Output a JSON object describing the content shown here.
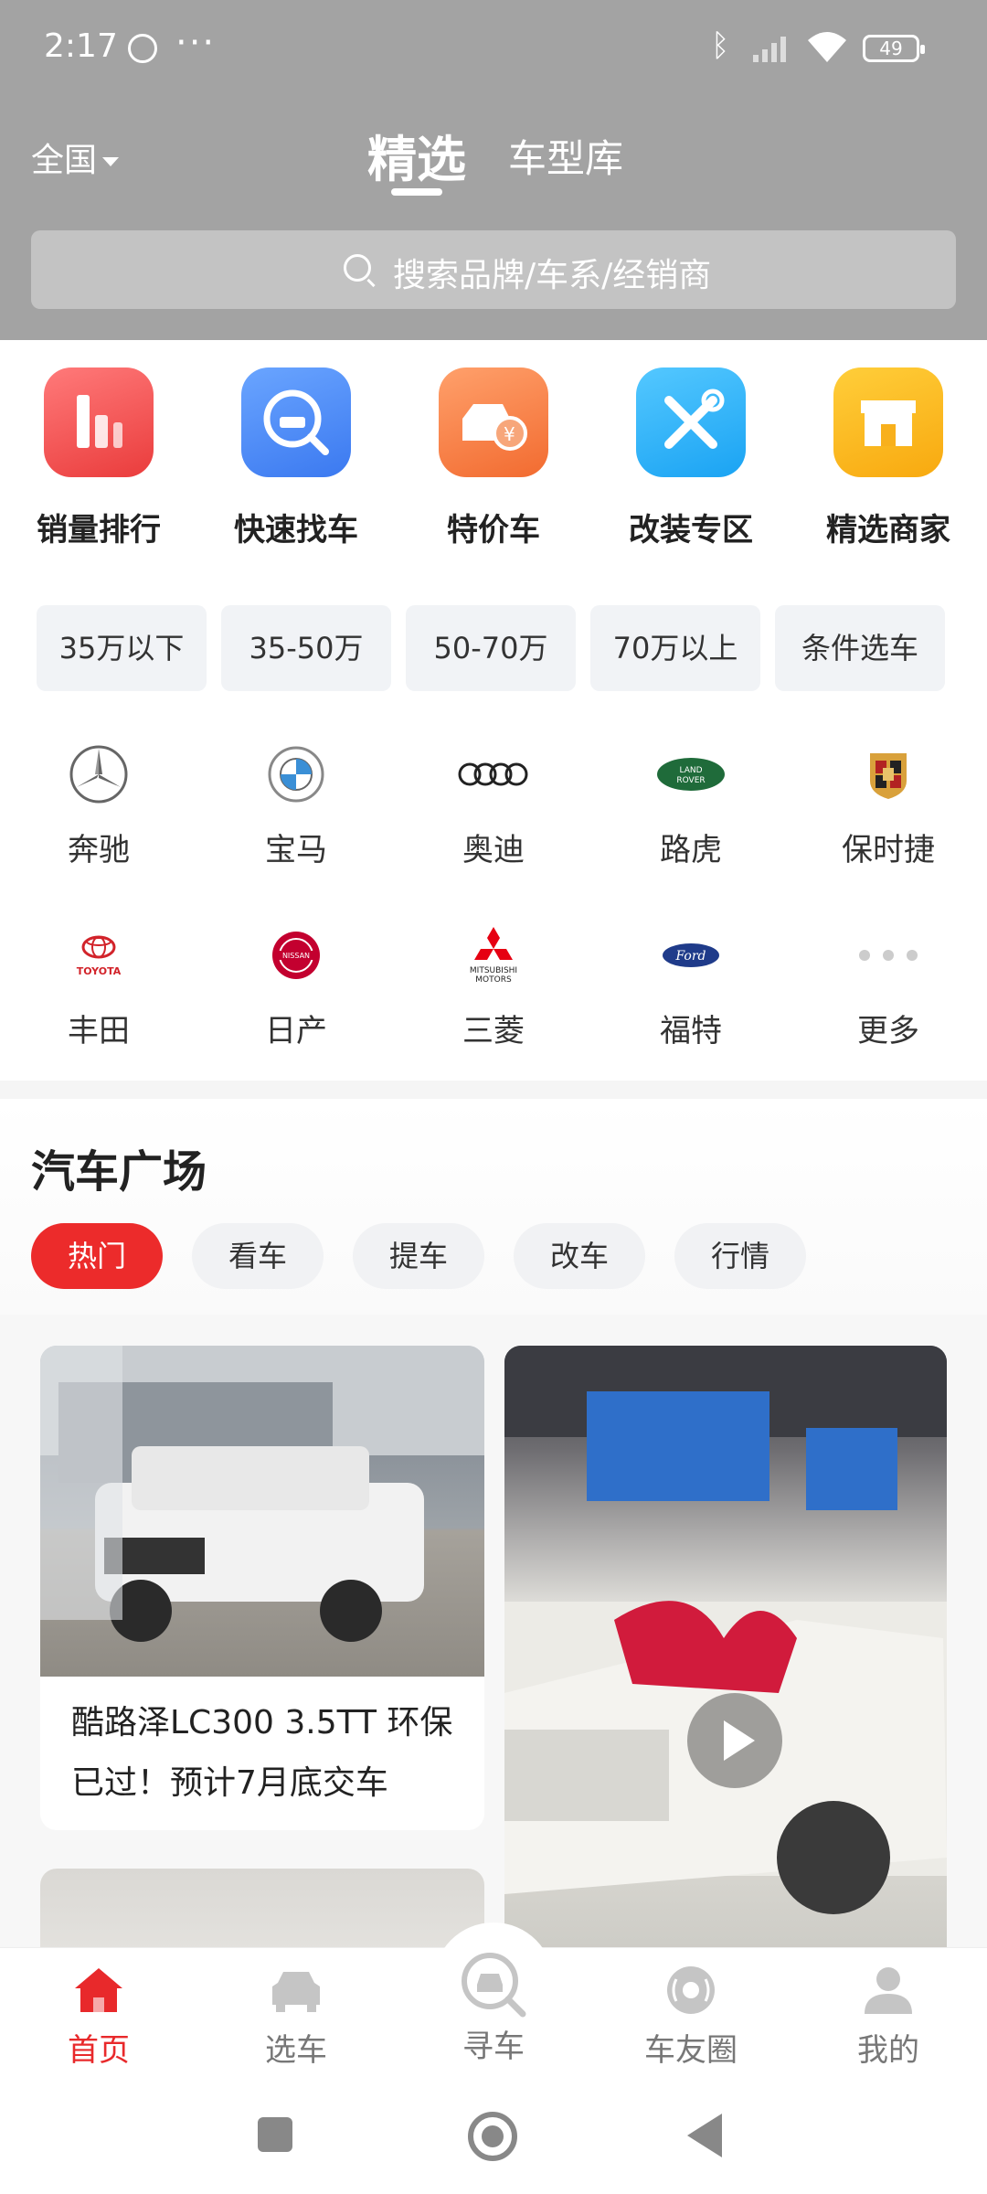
{
  "status_bar": {
    "time": "2:17",
    "dots": "···",
    "battery": "49"
  },
  "header": {
    "region": "全国",
    "tabs": [
      {
        "label": "精选",
        "active": true
      },
      {
        "label": "车型库",
        "active": false
      }
    ],
    "search_placeholder": "搜索品牌/车系/经销商"
  },
  "features": [
    {
      "label": "销量排行",
      "icon": "sales-ranking-icon",
      "color": "#ea3c3c"
    },
    {
      "label": "快速找车",
      "icon": "quick-find-car-icon",
      "color": "#3b79f0"
    },
    {
      "label": "特价车",
      "icon": "discount-car-icon",
      "color": "#f26b30"
    },
    {
      "label": "改装专区",
      "icon": "modification-tools-icon",
      "color": "#1aa3f3"
    },
    {
      "label": "精选商家",
      "icon": "store-icon",
      "color": "#f8a90f"
    }
  ],
  "price_chips": [
    "35万以下",
    "35-50万",
    "50-70万",
    "70万以上",
    "条件选车"
  ],
  "brands": [
    {
      "label": "奔驰",
      "icon": "mercedes-logo-icon"
    },
    {
      "label": "宝马",
      "icon": "bmw-logo-icon"
    },
    {
      "label": "奥迪",
      "icon": "audi-logo-icon"
    },
    {
      "label": "路虎",
      "icon": "land-rover-logo-icon",
      "logo_text": "LAND ROVER"
    },
    {
      "label": "保时捷",
      "icon": "porsche-logo-icon"
    },
    {
      "label": "丰田",
      "icon": "toyota-logo-icon",
      "logo_text": "TOYOTA"
    },
    {
      "label": "日产",
      "icon": "nissan-logo-icon",
      "logo_text": "NISSAN"
    },
    {
      "label": "三菱",
      "icon": "mitsubishi-logo-icon",
      "logo_text": "MITSUBISHI MOTORS"
    },
    {
      "label": "福特",
      "icon": "ford-logo-icon",
      "logo_text": "Ford"
    },
    {
      "label": "更多",
      "icon": "more-dots-icon"
    }
  ],
  "plaza": {
    "title": "汽车广场",
    "tabs": [
      {
        "label": "热门",
        "active": true
      },
      {
        "label": "看车",
        "active": false
      },
      {
        "label": "提车",
        "active": false
      },
      {
        "label": "改车",
        "active": false
      },
      {
        "label": "行情",
        "active": false
      }
    ]
  },
  "feed": {
    "card1_title": "酷路泽LC300 3.5TT 环保已过！预计7月底交车"
  },
  "bottom_nav": [
    {
      "label": "首页",
      "icon": "home-icon",
      "active": true
    },
    {
      "label": "选车",
      "icon": "car-icon",
      "active": false
    },
    {
      "label": "寻车",
      "icon": "find-car-icon",
      "active": false
    },
    {
      "label": "车友圈",
      "icon": "community-icon",
      "active": false
    },
    {
      "label": "我的",
      "icon": "profile-icon",
      "active": false
    }
  ],
  "colors": {
    "accent": "#e8292b",
    "header_bg": "#a3a3a3"
  }
}
